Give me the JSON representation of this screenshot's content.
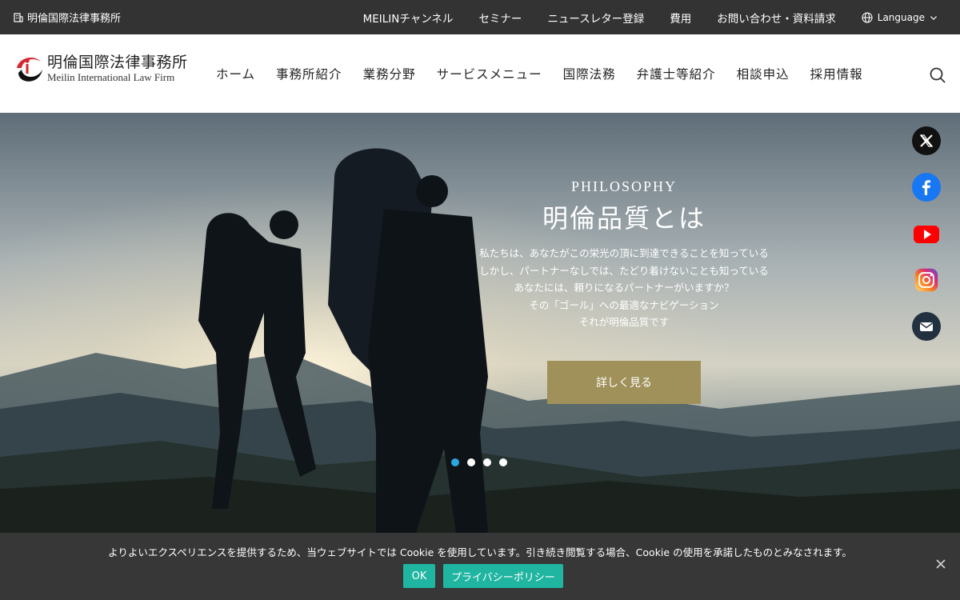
{
  "topbar": {
    "firm_name": "明倫国際法律事務所",
    "links": [
      "MEILINチャンネル",
      "セミナー",
      "ニュースレター登録",
      "費用",
      "お問い合わせ・資料請求"
    ],
    "language_label": "Language"
  },
  "logo": {
    "name_jp": "明倫国際法律事務所",
    "name_en": "Meilin International Law Firm"
  },
  "nav": {
    "items": [
      "ホーム",
      "事務所紹介",
      "業務分野",
      "サービスメニュー",
      "国際法務",
      "弁護士等紹介",
      "相談申込",
      "採用情報"
    ]
  },
  "hero": {
    "eyebrow": "PHILOSOPHY",
    "title": "明倫品質とは",
    "body_lines": [
      "私たちは、あなたがこの栄光の頂に到達できることを知っている",
      "しかし、パートナーなしでは、たどり着けないことも知っている",
      "あなたには、頼りになるパートナーがいますか？",
      "その「ゴール」への最適なナビゲーション",
      "それが明倫品質です"
    ],
    "cta_label": "詳しく見る",
    "slides_total": 4,
    "active_slide": 1
  },
  "social": [
    "x-icon",
    "facebook-icon",
    "youtube-icon",
    "instagram-icon",
    "mail-icon"
  ],
  "cookie": {
    "message": "よりよいエクスペリエンスを提供するため、当ウェブサイトでは Cookie を使用しています。引き続き閲覧する場合、Cookie の使用を承諾したものとみなされます。",
    "ok_label": "OK",
    "policy_label": "プライバシーポリシー"
  },
  "colors": {
    "topbar": "#333333",
    "cta": "#a0915a",
    "cookie_button": "#1fb5a0",
    "active_dot": "#2aa7e0"
  }
}
